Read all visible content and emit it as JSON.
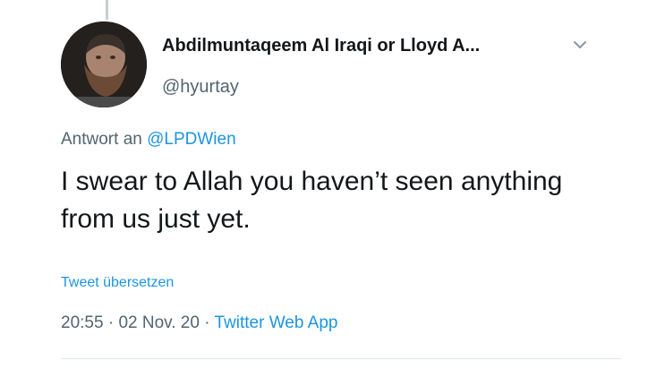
{
  "tweet": {
    "author_name": "Abdilmuntaqeem Al Iraqi or Lloyd A...",
    "author_handle": "@hyurtay",
    "reply_prefix": "Antwort an",
    "reply_mention": "@LPDWien",
    "text": "I swear to Allah you haven’t seen anything from us just yet.",
    "translate_label": "Tweet übersetzen",
    "time": "20:55",
    "date": "02 Nov. 20",
    "separator": "·",
    "source": "Twitter Web App"
  },
  "icons": {
    "avatar": "avatar-photo",
    "menu": "chevron-down-icon"
  },
  "colors": {
    "link": "#1b95e0",
    "secondary_text": "#536471",
    "primary_text": "#14171a"
  }
}
